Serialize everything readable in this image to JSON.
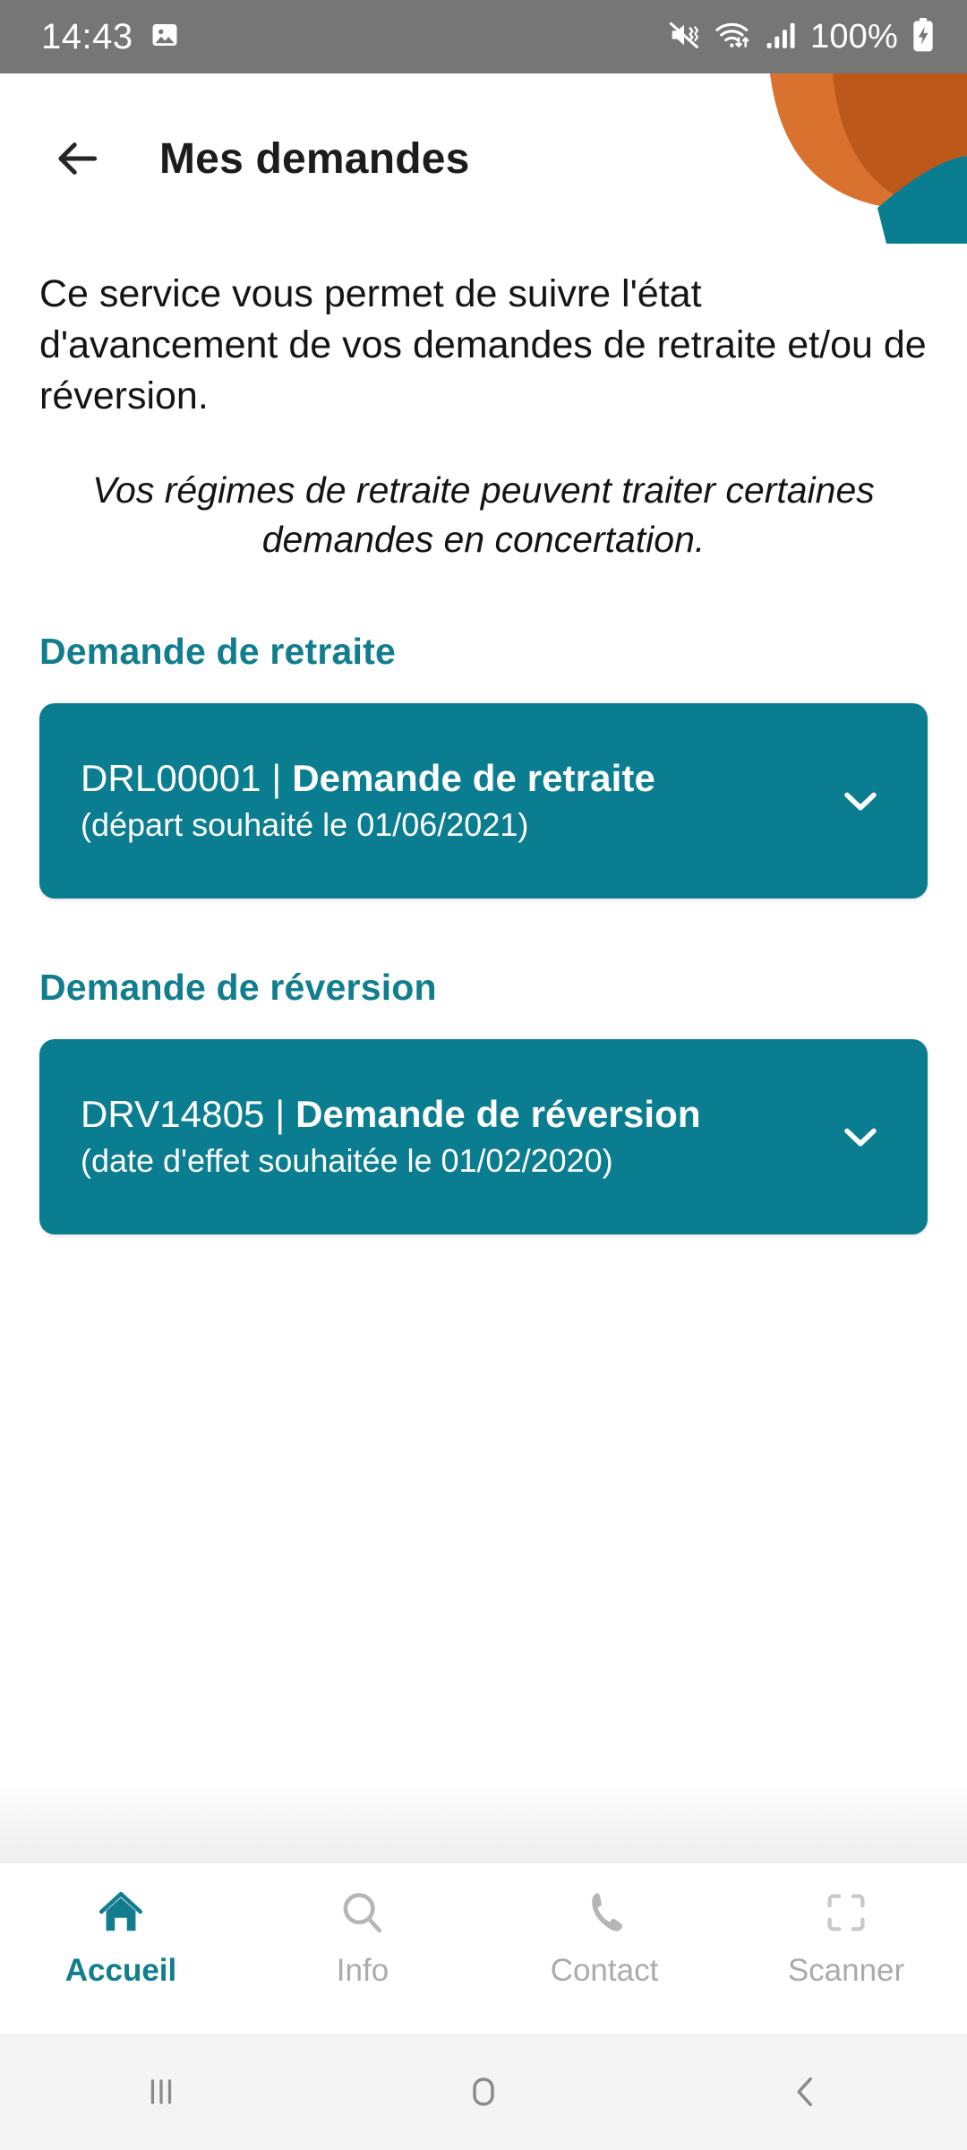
{
  "statusbar": {
    "time": "14:43",
    "screenshot_icon": "image-icon",
    "mute_icon": "mute-vibrate-icon",
    "wifi_icon": "wifi-transfer-icon",
    "signal_icon": "cellular-signal-icon",
    "battery_text": "100%",
    "battery_icon": "battery-charging-icon"
  },
  "header": {
    "back_icon": "back-arrow-icon",
    "title": "Mes demandes",
    "decoration": {
      "orange_light": "#D9722E",
      "orange_dark": "#BD581B",
      "teal": "#0B7D90"
    }
  },
  "content": {
    "intro": "Ce service vous permet de suivre l'état d'avancement de vos demandes de retraite et/ou de réversion.",
    "note": "Vos régimes de retraite peuvent traiter certaines demandes en concertation.",
    "sections": [
      {
        "title": "Demande de retraite",
        "card": {
          "reference": "DRL00001",
          "separator": "|",
          "label": "Demande de retraite",
          "detail": "(départ souhaité le 01/06/2021)",
          "expand_icon": "chevron-down-icon"
        }
      },
      {
        "title": "Demande de réversion",
        "card": {
          "reference": "DRV14805",
          "separator": "|",
          "label": "Demande de réversion",
          "detail": "(date d'effet souhaitée le 01/02/2020)",
          "expand_icon": "chevron-down-icon"
        }
      }
    ]
  },
  "tabbar": {
    "items": [
      {
        "label": "Accueil",
        "icon": "home-icon",
        "active": true
      },
      {
        "label": "Info",
        "icon": "search-icon",
        "active": false
      },
      {
        "label": "Contact",
        "icon": "phone-icon",
        "active": false
      },
      {
        "label": "Scanner",
        "icon": "scan-frame-icon",
        "active": false
      }
    ]
  },
  "navbar": {
    "recents_icon": "recents-icon",
    "home_icon": "home-square-icon",
    "back_icon": "back-chevron-icon"
  },
  "colors": {
    "teal": "#0B7D90",
    "teal_text": "#117D8E",
    "statusbar": "#767676",
    "inactive_gray": "#ABABAB"
  }
}
